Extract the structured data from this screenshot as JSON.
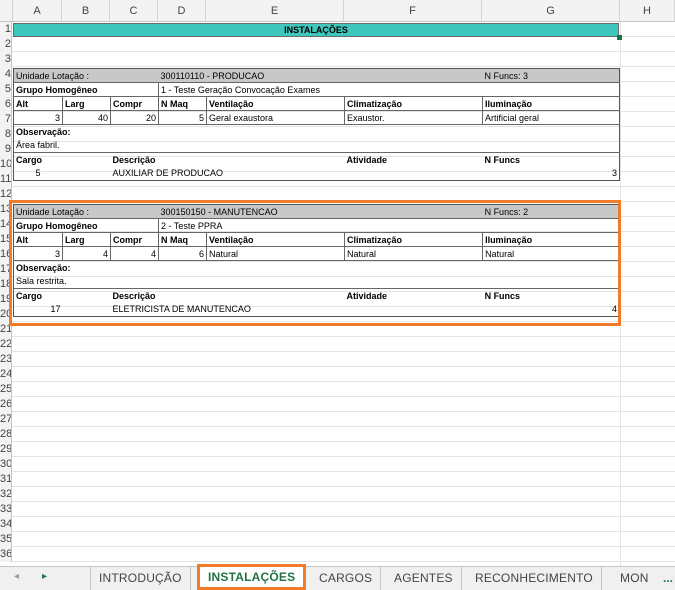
{
  "columns": [
    "A",
    "B",
    "C",
    "D",
    "E",
    "F",
    "G",
    "H"
  ],
  "rows": [
    "1",
    "2",
    "3",
    "4",
    "5",
    "6",
    "7",
    "8",
    "9",
    "10",
    "11",
    "12",
    "13",
    "14",
    "15",
    "16",
    "17",
    "18",
    "19",
    "20",
    "21",
    "22",
    "23",
    "24",
    "25",
    "26",
    "27",
    "28",
    "29",
    "30",
    "31",
    "32",
    "33",
    "34",
    "35",
    "36"
  ],
  "title": "INSTALAÇÕES",
  "blocks": [
    {
      "unidade_label": "Unidade Lotação :",
      "unidade_value": "300110110 - PRODUCAO",
      "nfuncs_header": "N Funcs: 3",
      "grupo_label": "Grupo Homogêneo",
      "grupo_value": "1 - Teste Geração Convocação Exames",
      "dims_headers": [
        "Alt",
        "Larg",
        "Compr",
        "N Maq",
        "Ventilação",
        "Climatização",
        "Iluminação"
      ],
      "dims_values": [
        "3",
        "40",
        "20",
        "5",
        "Geral exaustora",
        "Exaustor.",
        "Artificial geral"
      ],
      "obs_label": "Observação:",
      "obs_text": "Área fabril.",
      "cargo_headers": [
        "Cargo",
        "Descrição",
        "Atividade",
        "N Funcs"
      ],
      "cargo_values": [
        "5",
        "AUXILIAR DE PRODUCAO",
        "",
        "3"
      ]
    },
    {
      "unidade_label": "Unidade Lotação :",
      "unidade_value": "300150150 - MANUTENCAO",
      "nfuncs_header": "N Funcs: 2",
      "grupo_label": "Grupo Homogêneo",
      "grupo_value": "2 - Teste PPRA",
      "dims_headers": [
        "Alt",
        "Larg",
        "Compr",
        "N Maq",
        "Ventilação",
        "Climatização",
        "Iluminação"
      ],
      "dims_values": [
        "3",
        "4",
        "4",
        "6",
        "Natural",
        "Natural",
        "Natural"
      ],
      "obs_label": "Observação:",
      "obs_text": "Sala restrita.",
      "cargo_headers": [
        "Cargo",
        "Descrição",
        "Atividade",
        "N Funcs"
      ],
      "cargo_values": [
        "17",
        "ELETRICISTA DE MANUTENCAO",
        "",
        "4"
      ]
    }
  ],
  "tabs": {
    "prev_icon": "◂",
    "next_icon": "▸",
    "items": [
      "INTRODUÇÃO",
      "INSTALAÇÕES",
      "CARGOS",
      "AGENTES",
      "RECONHECIMENTO",
      "MON"
    ],
    "active": "INSTALAÇÕES",
    "more": "..."
  },
  "colors": {
    "title_fill": "#3ec7bd",
    "header_fill": "#c8c8c8",
    "highlight": "#f07c2a",
    "excel_green": "#217346"
  }
}
